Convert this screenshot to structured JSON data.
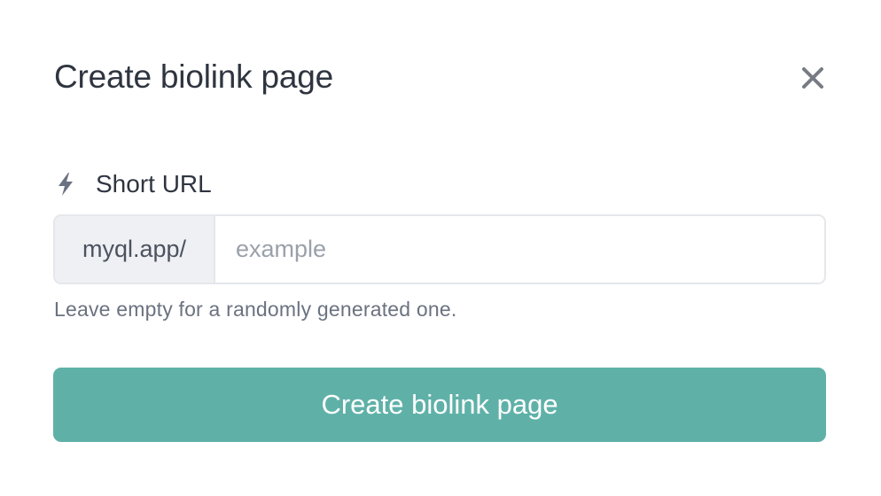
{
  "modal": {
    "title": "Create biolink page",
    "close_icon": "close-icon"
  },
  "short_url": {
    "icon": "bolt-icon",
    "label": "Short URL",
    "prefix": "myql.app/",
    "value": "",
    "placeholder": "example",
    "help_text": "Leave empty for a randomly generated one."
  },
  "submit": {
    "label": "Create biolink page"
  },
  "colors": {
    "accent": "#5fb1a8",
    "title_text": "#2f3540",
    "muted_text": "#6b7280",
    "prefix_bg": "#eef0f3"
  }
}
